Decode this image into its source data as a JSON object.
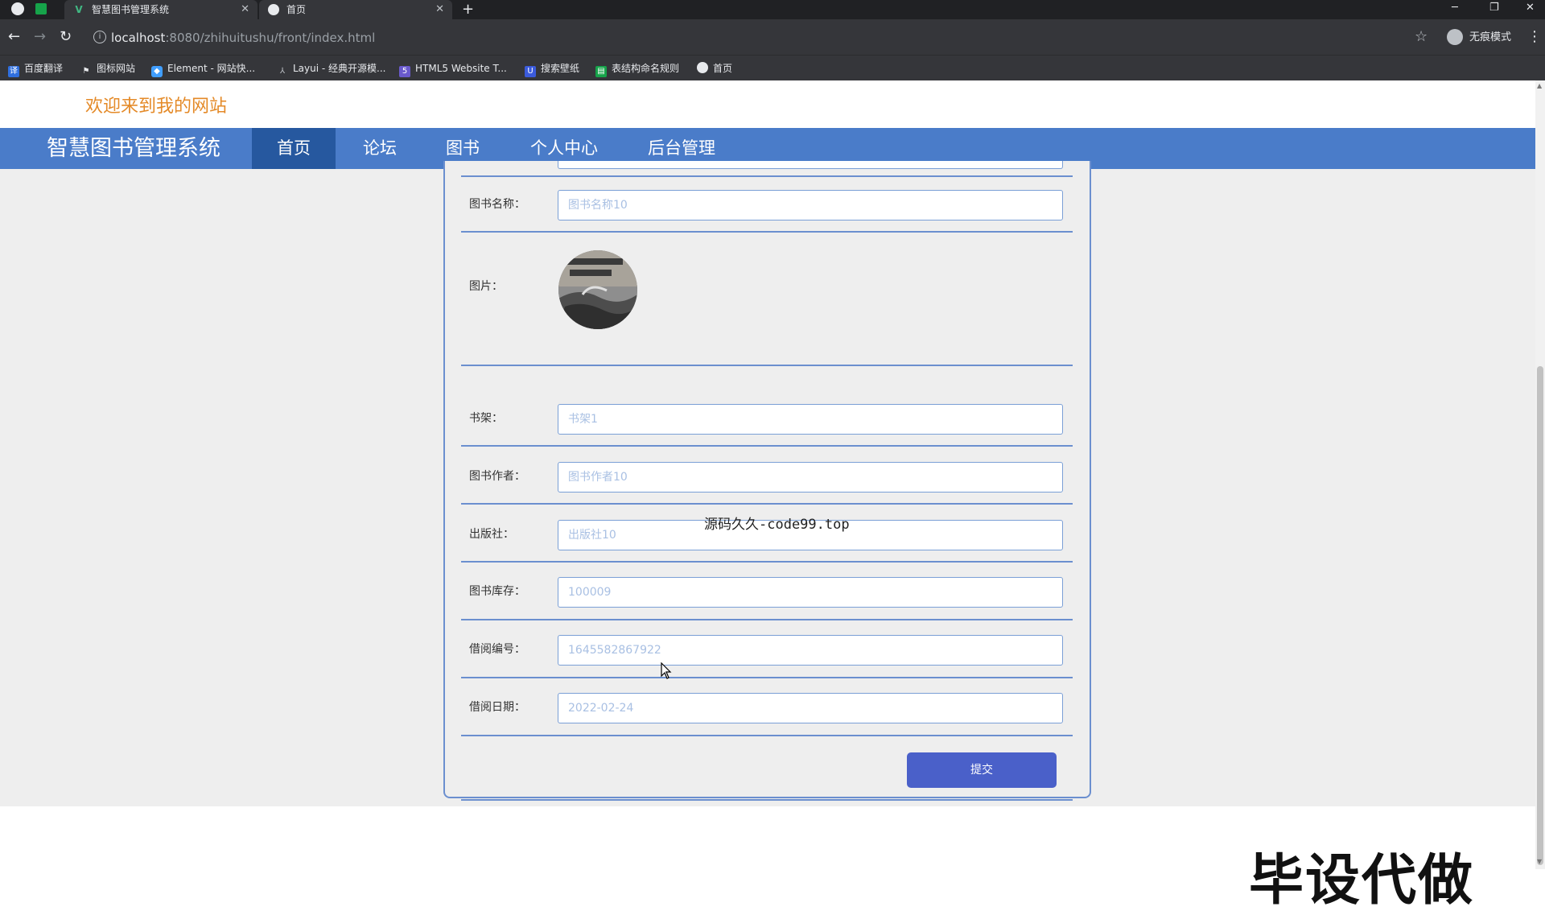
{
  "browser": {
    "tabs": [
      {
        "title": "智慧图书管理系统",
        "active": false,
        "icon": "vue-logo-icon"
      },
      {
        "title": "首页",
        "active": true,
        "icon": "globe-icon"
      }
    ],
    "url_host": "localhost",
    "url_rest": ":8080/zhihuitushu/front/index.html",
    "incognito_label": "无痕模式",
    "bookmarks": [
      {
        "label": "百度翻译",
        "icon": "translate-icon",
        "color": "#2f6fdf"
      },
      {
        "label": "图标网站",
        "icon": "flag-icon",
        "color": "#e8eaed"
      },
      {
        "label": "Element - 网站快...",
        "icon": "element-icon",
        "color": "#409eff"
      },
      {
        "label": "Layui - 经典开源模...",
        "icon": "layui-icon",
        "color": "#009688"
      },
      {
        "label": "HTML5 Website T...",
        "icon": "html5-icon",
        "color": "#6a5acd"
      },
      {
        "label": "搜索壁纸",
        "icon": "wallpaper-icon",
        "color": "#3b5bdb"
      },
      {
        "label": "表结构命名规则",
        "icon": "sheet-icon",
        "color": "#16a34a"
      },
      {
        "label": "首页",
        "icon": "globe-icon",
        "color": "#e8eaed"
      }
    ]
  },
  "header": {
    "welcome": "欢迎来到我的网站",
    "brand": "智慧图书管理系统",
    "nav": [
      {
        "label": "首页",
        "active": true
      },
      {
        "label": "论坛",
        "active": false
      },
      {
        "label": "图书",
        "active": false
      },
      {
        "label": "个人中心",
        "active": false
      },
      {
        "label": "后台管理",
        "active": false
      }
    ]
  },
  "form": {
    "fields": {
      "book_name": {
        "label": "图书名称：",
        "placeholder": "图书名称10"
      },
      "image": {
        "label": "图片："
      },
      "shelf": {
        "label": "书架：",
        "placeholder": "书架1"
      },
      "author": {
        "label": "图书作者：",
        "placeholder": "图书作者10"
      },
      "publisher": {
        "label": "出版社：",
        "placeholder": "出版社10"
      },
      "stock": {
        "label": "图书库存：",
        "placeholder": "100009"
      },
      "borrow_no": {
        "label": "借阅编号：",
        "placeholder": "1645582867922"
      },
      "borrow_date": {
        "label": "借阅日期：",
        "placeholder": "2022-02-24"
      }
    },
    "submit_label": "提交"
  },
  "overlays": {
    "center_watermark": "源码久久-code99.top",
    "corner_watermark": "毕设代做"
  },
  "colors": {
    "nav_bg": "#4a7cc9",
    "nav_active": "#26589f",
    "welcome": "#e48a28",
    "submit": "#4a60c9"
  }
}
